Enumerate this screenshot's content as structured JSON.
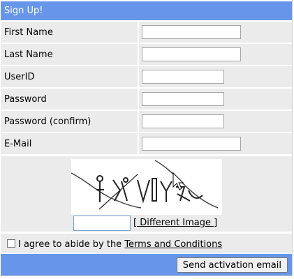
{
  "form": {
    "title": "Sign Up!",
    "fields": [
      {
        "label": "First Name",
        "value": ""
      },
      {
        "label": "Last Name",
        "value": ""
      },
      {
        "label": "UserID",
        "value": ""
      },
      {
        "label": "Password",
        "value": ""
      },
      {
        "label": "Password (confirm)",
        "value": ""
      },
      {
        "label": "E-Mail",
        "value": ""
      }
    ],
    "captcha": {
      "image_icon": "captcha-image",
      "input_value": "",
      "different_image_label": "[ Different Image ]"
    },
    "agree": {
      "prefix": "I agree to abide by the ",
      "link_label": "Terms and Conditions",
      "checked": false
    },
    "submit_label": "Send activation email"
  },
  "colors": {
    "header_bg": "#6795e9",
    "row_bg": "#ebebeb"
  }
}
